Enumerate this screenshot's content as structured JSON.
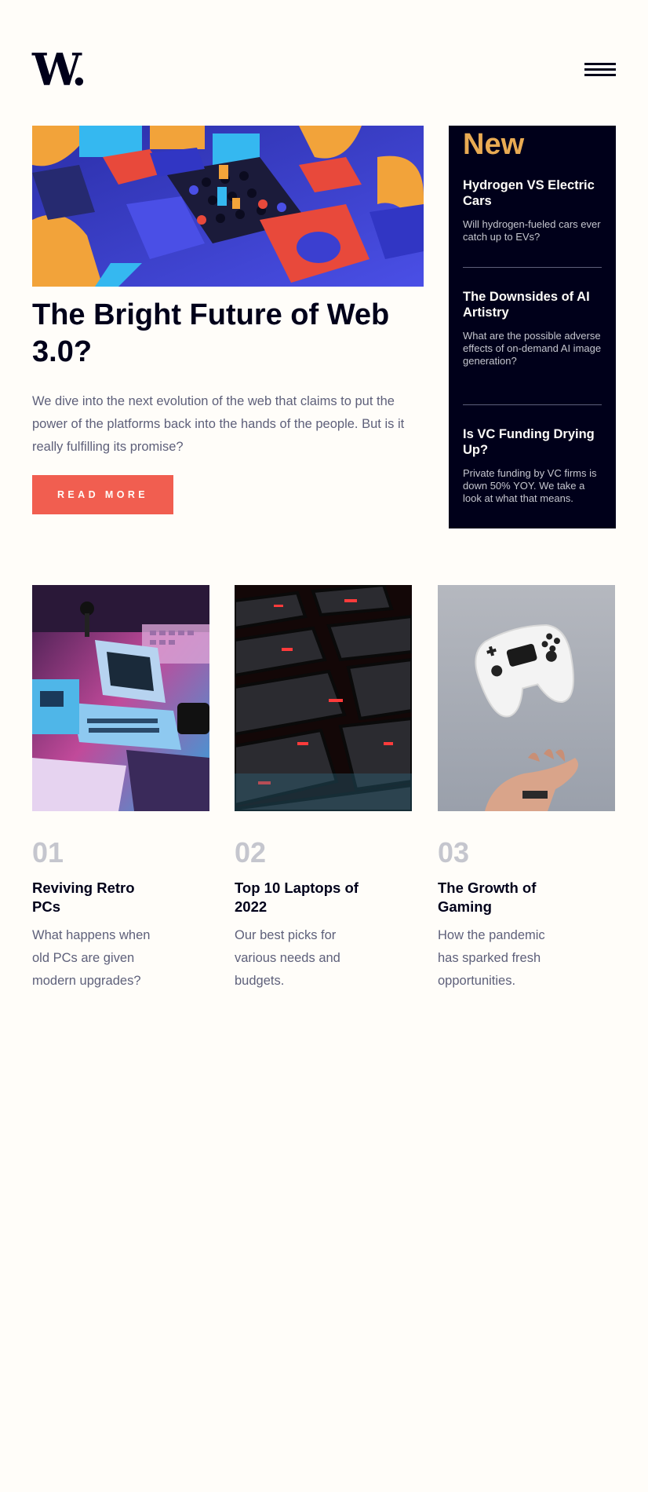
{
  "header": {
    "logo": "W.",
    "menu_icon": "hamburger-menu-icon"
  },
  "hero": {
    "image_icon": "colorful-3d-blocks-image",
    "title": "The Bright Future of Web 3.0?",
    "description": "We dive into the next evolution of the web that claims to put the power of the platforms back into the hands of the people. But is it really fulfilling its promise?",
    "button_label": "READ MORE"
  },
  "new_section": {
    "heading": "New",
    "items": [
      {
        "title": "Hydrogen VS Electric Cars",
        "description": "Will hydrogen-fueled cars ever catch up to EVs?"
      },
      {
        "title": "The Downsides of AI Artistry",
        "description": "What are the possible adverse effects of on-demand AI image generation?"
      },
      {
        "title": "Is VC Funding Drying Up?",
        "description": "Private funding by VC firms is down 50% YOY. We take a look at what that means."
      }
    ]
  },
  "cards": [
    {
      "number": "01",
      "title": "Reviving Retro PCs",
      "description": "What happens when old PCs are given modern upgrades?",
      "image_icon": "retro-computer-image"
    },
    {
      "number": "02",
      "title": "Top 10 Laptops of 2022",
      "description": "Our best picks for various needs and budgets.",
      "image_icon": "keyboard-closeup-image"
    },
    {
      "number": "03",
      "title": "The Growth of Gaming",
      "description": "How the pandemic has sparked fresh opportunities.",
      "image_icon": "game-controller-image"
    }
  ],
  "colors": {
    "background": "#fffdf9",
    "dark_navy": "#00001a",
    "accent_red": "#f15e50",
    "accent_orange": "#e9ab53",
    "text_gray": "#5e607a",
    "light_gray": "#c5c6ce"
  }
}
